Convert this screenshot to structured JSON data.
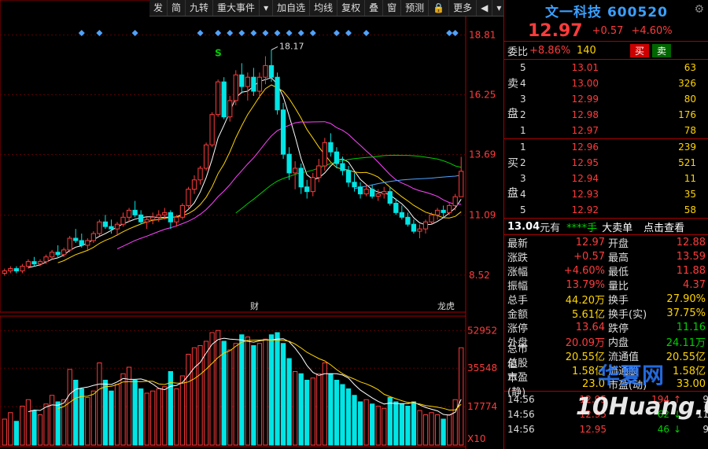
{
  "toolbar": {
    "buttons": [
      "发",
      "简",
      "九转",
      "重大事件",
      "▾",
      "加自选",
      "均线",
      "复权",
      "叠",
      "窗",
      "预测",
      "🔒",
      "更多",
      "◀",
      "▾"
    ]
  },
  "chart": {
    "price_ticks": [
      "18.81",
      "16.25",
      "13.69",
      "11.09",
      "8.52"
    ],
    "high_label": "18.17",
    "s_marker": "S",
    "cai_label": "财",
    "long_label": "龙虎",
    "vol_ticks": [
      "52952",
      "35548",
      "17774"
    ],
    "vol_unit": "X10"
  },
  "chart_data": {
    "type": "candlestick",
    "price_range": [
      7.0,
      19.5
    ],
    "candles": [
      [
        8.6,
        8.8,
        8.5,
        8.7
      ],
      [
        8.7,
        8.9,
        8.6,
        8.8
      ],
      [
        8.8,
        8.9,
        8.6,
        8.7
      ],
      [
        8.7,
        9.0,
        8.6,
        8.9
      ],
      [
        8.9,
        9.2,
        8.8,
        9.1
      ],
      [
        9.1,
        9.3,
        8.9,
        9.0
      ],
      [
        9.0,
        9.2,
        8.9,
        9.1
      ],
      [
        9.1,
        9.4,
        9.0,
        9.3
      ],
      [
        9.3,
        9.6,
        9.2,
        9.5
      ],
      [
        9.5,
        9.8,
        9.3,
        9.4
      ],
      [
        9.4,
        9.7,
        9.3,
        9.6
      ],
      [
        9.6,
        10.2,
        9.5,
        10.1
      ],
      [
        10.1,
        10.5,
        9.9,
        10.0
      ],
      [
        10.0,
        10.3,
        9.7,
        9.8
      ],
      [
        9.8,
        10.1,
        9.6,
        10.0
      ],
      [
        10.0,
        10.4,
        9.9,
        10.3
      ],
      [
        10.3,
        10.9,
        10.2,
        10.8
      ],
      [
        10.8,
        11.1,
        10.5,
        10.6
      ],
      [
        10.6,
        10.9,
        10.3,
        10.5
      ],
      [
        10.5,
        10.8,
        10.2,
        10.7
      ],
      [
        10.7,
        11.2,
        10.6,
        11.0
      ],
      [
        11.0,
        11.4,
        10.8,
        11.3
      ],
      [
        11.3,
        11.7,
        11.0,
        11.1
      ],
      [
        11.1,
        11.3,
        10.7,
        10.8
      ],
      [
        10.8,
        11.0,
        10.5,
        10.9
      ],
      [
        10.9,
        11.2,
        10.7,
        11.0
      ],
      [
        11.0,
        11.3,
        10.8,
        11.1
      ],
      [
        11.1,
        11.4,
        10.9,
        11.2
      ],
      [
        11.2,
        11.3,
        10.5,
        10.8
      ],
      [
        10.8,
        11.1,
        10.6,
        11.0
      ],
      [
        11.0,
        11.6,
        10.9,
        11.5
      ],
      [
        11.5,
        12.3,
        11.4,
        12.2
      ],
      [
        12.2,
        12.8,
        12.0,
        12.6
      ],
      [
        12.6,
        13.2,
        12.4,
        13.1
      ],
      [
        13.1,
        14.2,
        13.0,
        14.1
      ],
      [
        14.1,
        15.5,
        14.0,
        15.4
      ],
      [
        15.4,
        16.9,
        15.3,
        16.8
      ],
      [
        16.8,
        17.0,
        15.2,
        15.3
      ],
      [
        15.3,
        16.2,
        15.1,
        16.0
      ],
      [
        16.0,
        17.3,
        15.8,
        17.1
      ],
      [
        17.1,
        17.6,
        16.3,
        16.6
      ],
      [
        16.6,
        17.2,
        16.0,
        17.0
      ],
      [
        17.0,
        17.4,
        16.2,
        16.4
      ],
      [
        16.4,
        17.2,
        16.1,
        17.0
      ],
      [
        17.0,
        17.9,
        16.7,
        17.5
      ],
      [
        17.5,
        18.17,
        16.8,
        17.0
      ],
      [
        17.0,
        17.2,
        15.4,
        15.6
      ],
      [
        15.6,
        15.9,
        13.5,
        13.7
      ],
      [
        13.7,
        14.0,
        12.6,
        12.9
      ],
      [
        12.9,
        13.4,
        12.2,
        13.1
      ],
      [
        13.1,
        13.3,
        12.0,
        12.3
      ],
      [
        12.3,
        12.6,
        11.8,
        12.1
      ],
      [
        12.1,
        12.9,
        11.9,
        12.7
      ],
      [
        12.7,
        13.5,
        12.5,
        13.2
      ],
      [
        13.2,
        14.4,
        13.0,
        14.2
      ],
      [
        14.2,
        14.6,
        13.6,
        13.8
      ],
      [
        13.8,
        14.0,
        13.1,
        13.3
      ],
      [
        13.3,
        13.6,
        12.8,
        13.0
      ],
      [
        13.0,
        13.2,
        12.3,
        12.5
      ],
      [
        12.5,
        12.9,
        12.1,
        12.3
      ],
      [
        12.3,
        12.5,
        11.8,
        12.0
      ],
      [
        12.0,
        12.4,
        11.9,
        12.2
      ],
      [
        12.2,
        12.4,
        11.8,
        11.9
      ],
      [
        11.9,
        12.2,
        11.7,
        12.0
      ],
      [
        12.0,
        12.3,
        11.8,
        12.1
      ],
      [
        12.1,
        12.3,
        11.5,
        11.6
      ],
      [
        11.6,
        11.8,
        11.1,
        11.2
      ],
      [
        11.2,
        11.5,
        10.9,
        11.0
      ],
      [
        11.0,
        11.2,
        10.6,
        10.7
      ],
      [
        10.7,
        10.9,
        10.3,
        10.4
      ],
      [
        10.4,
        10.7,
        10.1,
        10.5
      ],
      [
        10.5,
        10.9,
        10.3,
        10.8
      ],
      [
        10.8,
        11.2,
        10.7,
        11.1
      ],
      [
        11.1,
        11.4,
        10.9,
        11.3
      ],
      [
        11.3,
        11.5,
        11.0,
        11.2
      ],
      [
        11.2,
        11.6,
        11.1,
        11.5
      ],
      [
        11.5,
        12.0,
        11.3,
        11.88
      ],
      [
        11.88,
        13.59,
        11.88,
        12.97
      ]
    ],
    "volumes": [
      120,
      150,
      110,
      180,
      210,
      160,
      140,
      190,
      230,
      200,
      210,
      350,
      300,
      260,
      220,
      250,
      380,
      300,
      250,
      280,
      330,
      360,
      300,
      260,
      240,
      250,
      260,
      270,
      340,
      260,
      320,
      420,
      450,
      460,
      480,
      520,
      530,
      480,
      440,
      470,
      510,
      500,
      460,
      470,
      490,
      510,
      520,
      470,
      400,
      340,
      330,
      300,
      310,
      330,
      380,
      330,
      300,
      280,
      260,
      230,
      200,
      210,
      190,
      180,
      170,
      220,
      200,
      190,
      180,
      200,
      160,
      140,
      150,
      140,
      120,
      140,
      210,
      450
    ]
  },
  "quote": {
    "name": "文一科技 600520",
    "price": "12.97",
    "change": "+0.57",
    "change_pct": "+4.60%",
    "wb_label": "委比",
    "wb_value": "+8.86%",
    "wb_num": "140",
    "buy_btn": "买",
    "sell_btn": "卖"
  },
  "orderbook": {
    "sell_side_label": [
      "卖",
      "盘"
    ],
    "buy_side_label": [
      "买",
      "盘"
    ],
    "asks": [
      {
        "lvl": "5",
        "price": "13.01",
        "vol": "63"
      },
      {
        "lvl": "4",
        "price": "13.00",
        "vol": "326"
      },
      {
        "lvl": "3",
        "price": "12.99",
        "vol": "80"
      },
      {
        "lvl": "2",
        "price": "12.98",
        "vol": "176"
      },
      {
        "lvl": "1",
        "price": "12.97",
        "vol": "78"
      }
    ],
    "bids": [
      {
        "lvl": "1",
        "price": "12.96",
        "vol": "239"
      },
      {
        "lvl": "2",
        "price": "12.95",
        "vol": "521"
      },
      {
        "lvl": "3",
        "price": "12.94",
        "vol": "11"
      },
      {
        "lvl": "4",
        "price": "12.93",
        "vol": "35"
      },
      {
        "lvl": "5",
        "price": "12.92",
        "vol": "58"
      }
    ]
  },
  "ext": {
    "price": "13.04",
    "unit": "元有",
    "hand": "****手",
    "big": "大卖单",
    "link": "点击查看"
  },
  "stats": [
    {
      "l": "最新",
      "v": "12.97",
      "vc": "red",
      "l2": "开盘",
      "v2": "12.88",
      "v2c": "red"
    },
    {
      "l": "涨跌",
      "v": "+0.57",
      "vc": "red",
      "l2": "最高",
      "v2": "13.59",
      "v2c": "red"
    },
    {
      "l": "涨幅",
      "v": "+4.60%",
      "vc": "red",
      "l2": "最低",
      "v2": "11.88",
      "v2c": "red"
    },
    {
      "l": "振幅",
      "v": "13.79%",
      "vc": "red",
      "l2": "量比",
      "v2": "4.37",
      "v2c": "red"
    },
    {
      "l": "总手",
      "v": "44.20万",
      "vc": "yellow",
      "l2": "换手",
      "v2": "27.90%",
      "v2c": "yellow"
    },
    {
      "l": "金额",
      "v": "5.61亿",
      "vc": "yellow",
      "l2": "换手(实)",
      "v2": "37.75%",
      "v2c": "yellow"
    },
    {
      "l": "涨停",
      "v": "13.64",
      "vc": "red",
      "l2": "跌停",
      "v2": "11.16",
      "v2c": "green"
    },
    {
      "l": "外盘",
      "v": "20.09万",
      "vc": "red",
      "l2": "内盘",
      "v2": "24.11万",
      "v2c": "green"
    },
    {
      "l": "总市值",
      "v": "20.55亿",
      "vc": "yellow",
      "l2": "流通值",
      "v2": "20.55亿",
      "v2c": "yellow"
    },
    {
      "l": "总股本",
      "v": "1.58亿",
      "vc": "yellow",
      "l2": "流通股",
      "v2": "1.58亿",
      "v2c": "yellow"
    },
    {
      "l": "市盈(静)",
      "v": "23.0",
      "vc": "yellow",
      "l2": "市盈(动)",
      "v2": "33.00",
      "v2c": "yellow"
    }
  ],
  "ticks": [
    {
      "t": "14:56",
      "p": "12.95",
      "v": "194",
      "vc": "red",
      "a": "↑",
      "ac": "red",
      "n": "9"
    },
    {
      "t": "14:56",
      "p": "12.95",
      "v": "62",
      "vc": "green",
      "a": "↓",
      "ac": "green",
      "n": "11"
    },
    {
      "t": "14:56",
      "p": "12.95",
      "v": "46",
      "vc": "green",
      "a": "↓",
      "ac": "green",
      "n": "9"
    }
  ],
  "watermark": {
    "line1": "华夏网",
    "line2": "10Huang.CN"
  },
  "colors": {
    "up": "#ff3b3b",
    "down": "#00e5e5",
    "border": "#aa0000",
    "ma5": "#ffffff",
    "ma10": "#ffd400",
    "ma20": "#ff44ff",
    "ma60": "#00cc00",
    "ma120": "#4fa3ff"
  }
}
